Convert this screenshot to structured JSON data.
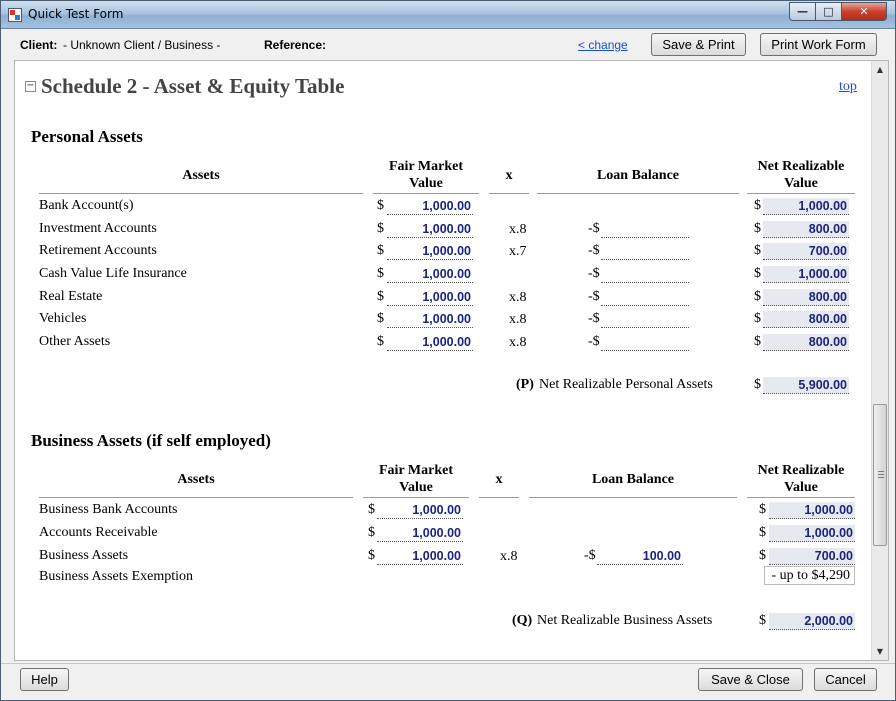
{
  "window": {
    "title": "Quick Test Form"
  },
  "header": {
    "client_label": "Client:",
    "client_value": "- Unknown Client / Business -",
    "reference_label": "Reference:",
    "change_link": "< change",
    "save_print": "Save & Print",
    "print_work_form": "Print Work Form"
  },
  "schedule": {
    "toggle": "−",
    "title": "Schedule 2 - Asset & Equity Table",
    "top_link": "top"
  },
  "personal": {
    "section_title": "Personal Assets",
    "headers": {
      "assets": "Assets",
      "fmv_line1": "Fair Market",
      "fmv_line2": "Value",
      "x": "x",
      "loan": "Loan Balance",
      "nrv_line1": "Net Realizable",
      "nrv_line2": "Value"
    },
    "rows": [
      {
        "label": "Bank Account(s)",
        "fmv": "1,000.00",
        "mult": "",
        "loan_prefix": "",
        "loan": "",
        "nrv": "1,000.00"
      },
      {
        "label": "Investment Accounts",
        "fmv": "1,000.00",
        "mult": "x.8",
        "loan_prefix": "-$",
        "loan": "",
        "nrv": "800.00"
      },
      {
        "label": "Retirement Accounts",
        "fmv": "1,000.00",
        "mult": "x.7",
        "loan_prefix": "-$",
        "loan": "",
        "nrv": "700.00"
      },
      {
        "label": "Cash Value Life Insurance",
        "fmv": "1,000.00",
        "mult": "",
        "loan_prefix": "-$",
        "loan": "",
        "nrv": "1,000.00"
      },
      {
        "label": "Real Estate",
        "fmv": "1,000.00",
        "mult": "x.8",
        "loan_prefix": "-$",
        "loan": "",
        "nrv": "800.00"
      },
      {
        "label": "Vehicles",
        "fmv": "1,000.00",
        "mult": "x.8",
        "loan_prefix": "-$",
        "loan": "",
        "nrv": "800.00"
      },
      {
        "label": "Other Assets",
        "fmv": "1,000.00",
        "mult": "x.8",
        "loan_prefix": "-$",
        "loan": "",
        "nrv": "800.00"
      }
    ],
    "total_key": "(P)",
    "total_label": "Net Realizable Personal Assets",
    "total_value": "5,900.00"
  },
  "business": {
    "section_title": "Business Assets (if self employed)",
    "headers": {
      "assets": "Assets",
      "fmv_line1": "Fair Market",
      "fmv_line2": "Value",
      "x": "x",
      "loan": "Loan Balance",
      "nrv_line1": "Net Realizable",
      "nrv_line2": "Value"
    },
    "rows": [
      {
        "label": "Business Bank Accounts",
        "fmv": "1,000.00",
        "mult": "",
        "loan_prefix": "",
        "loan": "",
        "nrv": "1,000.00"
      },
      {
        "label": "Accounts Receivable",
        "fmv": "1,000.00",
        "mult": "",
        "loan_prefix": "",
        "loan": "",
        "nrv": "1,000.00"
      },
      {
        "label": "Business Assets",
        "fmv": "1,000.00",
        "mult": "x.8",
        "loan_prefix": "-$",
        "loan": "100.00",
        "nrv": "700.00"
      }
    ],
    "exemption_label": "Business Assets Exemption",
    "exemption_value": "- up to $4,290",
    "total_key": "(Q)",
    "total_label": "Net Realizable Business Assets",
    "total_value": "2,000.00"
  },
  "currency": "$",
  "footer": {
    "help": "Help",
    "save_close": "Save & Close",
    "cancel": "Cancel"
  }
}
